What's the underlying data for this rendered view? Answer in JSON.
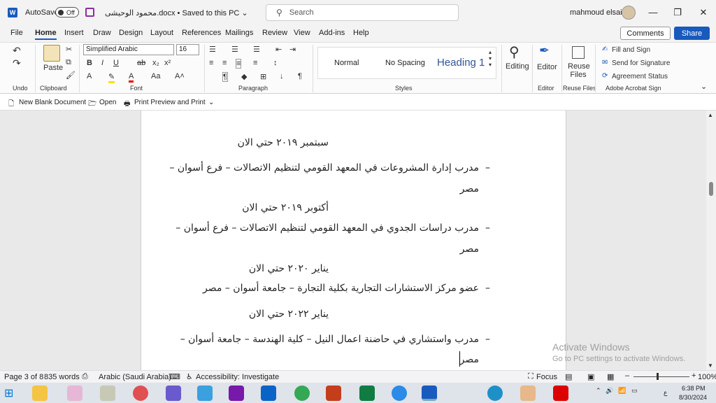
{
  "titlebar": {
    "autosave_label": "AutoSave",
    "autosave_state": "Off",
    "doc_title": "محمود الوحيشى.docx • Saved to this PC ⌄",
    "search_placeholder": "Search",
    "user_name": "mahmoud elsaid",
    "minimize": "—",
    "maximize": "❐",
    "close": "✕"
  },
  "menu": {
    "tabs": [
      "File",
      "Home",
      "Insert",
      "Draw",
      "Design",
      "Layout",
      "References",
      "Mailings",
      "Review",
      "View",
      "Add-ins",
      "Help"
    ],
    "active_tab": "Home",
    "comments": "Comments",
    "share": "Share"
  },
  "ribbon": {
    "undo_label": "Undo",
    "clipboard_label": "Clipboard",
    "paste": "Paste",
    "font_label": "Font",
    "font_name": "Simplified Arabic",
    "font_size": "16",
    "paragraph_label": "Paragraph",
    "styles_label": "Styles",
    "styles": [
      "Normal",
      "No Spacing",
      "Heading 1"
    ],
    "editing": "Editing",
    "editor": "Editor",
    "editor_label": "Editor",
    "reuse_files": "Reuse Files",
    "reuse_files_label": "Reuse Files",
    "fill_and_sign": "Fill and Sign",
    "send_for_signature": "Send for Signature",
    "agreement_status": "Agreement Status",
    "acrobat_label": "Adobe Acrobat Sign"
  },
  "qat": {
    "new_blank": "New Blank Document",
    "open": "Open",
    "print_preview": "Print Preview and Print"
  },
  "document": {
    "lines": [
      "سبتمبر ٢٠١٩ حتي الان",
      "مدرب إدارة المشروعات في المعهد القومي لتنظيم الاتصالات – فرع أسوان –",
      "مصر",
      "أكتوبر ٢٠١٩ حتي الان",
      "مدرب دراسات الجدوي في المعهد القومي لتنظيم الاتصالات – فرع أسوان –",
      "مصر",
      "يناير ٢٠٢٠ حتي الان",
      "عضو مركز الاستشارات التجارية بكلية التجارة – جامعة أسوان – مصر",
      "يناير ٢٠٢٢ حتي الان",
      "مدرب واستشاري في حاضنة اعمال النيل – كلية الهندسة – جامعة أسوان –",
      "مصر"
    ],
    "bullet": "–"
  },
  "watermark": {
    "line1": "Activate Windows",
    "line2": "Go to PC settings to activate Windows."
  },
  "status": {
    "page": "Page 3 of 8",
    "words": "835 words",
    "language": "Arabic (Saudi Arabia)",
    "accessibility": "Accessibility: Investigate",
    "focus": "Focus",
    "zoom": "100%"
  },
  "taskbar": {
    "time": "6:38 PM",
    "date": "8/30/2024",
    "lang": "ع"
  }
}
